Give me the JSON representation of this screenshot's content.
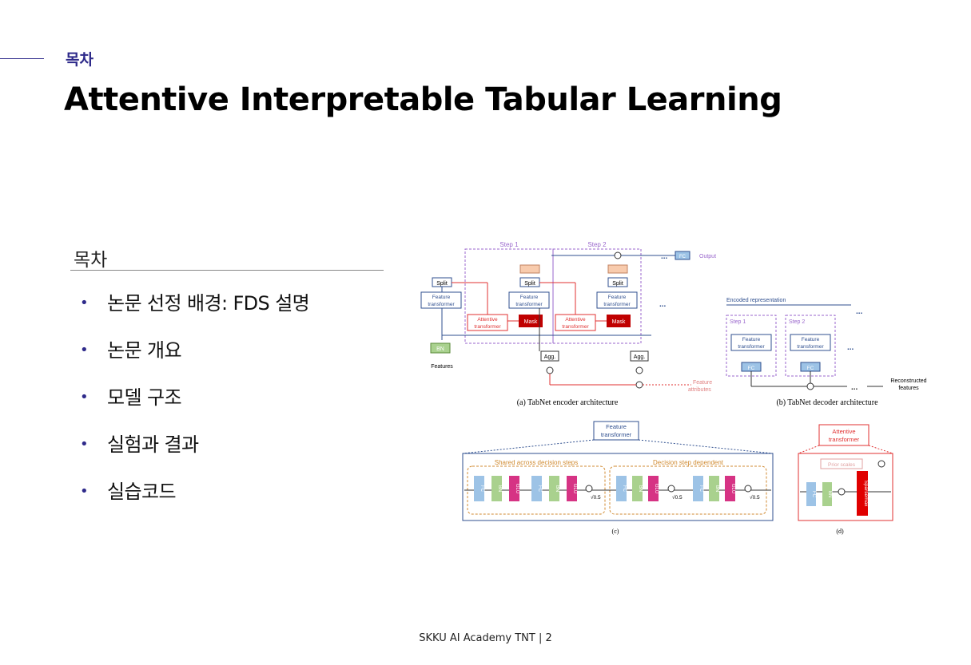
{
  "header": {
    "kicker": "목차",
    "title": "Attentive Interpretable Tabular Learning"
  },
  "toc": {
    "heading": "목차",
    "items": [
      "논문 선정 배경: FDS 설명",
      "논문 개요",
      "모델 구조",
      "실험과 결과",
      "실습코드"
    ]
  },
  "figure": {
    "encoder": {
      "step1": "Step 1",
      "step2": "Step 2",
      "split": "Split",
      "feature_transformer_1": "Feature",
      "feature_transformer_2": "transformer",
      "attentive_1": "Attentive",
      "attentive_2": "transformer",
      "mask": "Mask",
      "agg": "Agg.",
      "bn": "BN",
      "features": "Features",
      "fc": "FC",
      "output": "Output",
      "feature_attr_1": "Feature",
      "feature_attr_2": "attributes",
      "ellipsis": "...",
      "caption": "(a) TabNet encoder architecture"
    },
    "decoder": {
      "encoded": "Encoded representation",
      "step1": "Step 1",
      "step2": "Step 2",
      "fc": "FC",
      "recon_1": "Reconstructed",
      "recon_2": "features",
      "caption": "(b) TabNet decoder architecture"
    },
    "c": {
      "shared": "Shared across decision steps",
      "dependent": "Decision step dependent",
      "fc": "FC",
      "bn": "BN",
      "glu": "GLU",
      "sqrt": "√0.5",
      "caption": "(c)"
    },
    "d": {
      "prior": "Prior scales",
      "fc": "FC",
      "bn": "BN",
      "sparsemax": "Sparsemax",
      "caption": "(d)"
    }
  },
  "footer": "SKKU AI Academy TNT | 2",
  "colors": {
    "accent": "#2e2a8a",
    "fc_blue": "#9dc3e6",
    "bn_green": "#a9d18e",
    "glu_pink": "#d63384",
    "mask_red": "#c00000",
    "step_purple": "#9966cc",
    "attentive_red": "#e03030",
    "shared_orange": "#d08a30"
  }
}
